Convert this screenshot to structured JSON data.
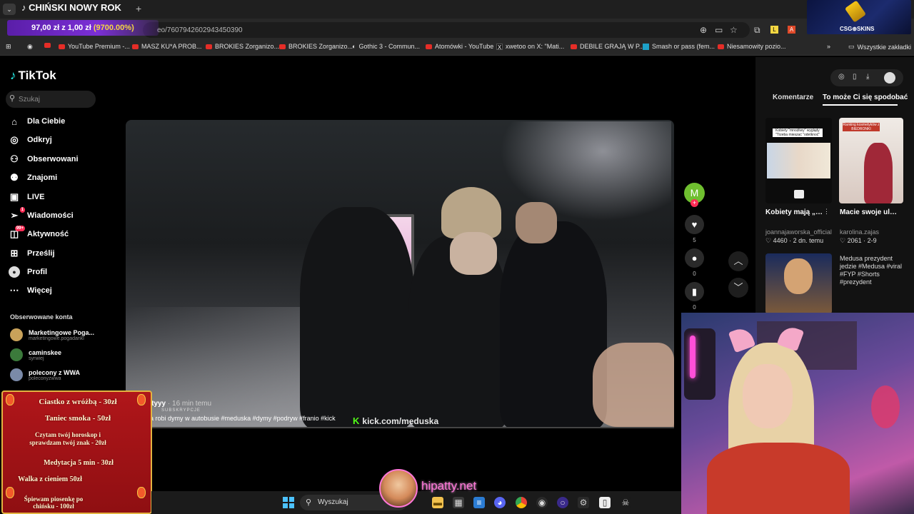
{
  "browser": {
    "tab_title": "CHIŃSKI NOWY ROK",
    "url": "eo/7607942602943450390",
    "bookmarks": [
      {
        "label": "YouTube Premium -...",
        "icon": "youtube"
      },
      {
        "label": "MASZ KU*A PROB...",
        "icon": "youtube"
      },
      {
        "label": "BROKIES Zorganizo...",
        "icon": "youtube"
      },
      {
        "label": "BROKIES Zorganizo...",
        "icon": "youtube"
      },
      {
        "label": "Gothic 3 - Commun...",
        "icon": "steam"
      },
      {
        "label": "Atomówki - YouTube",
        "icon": "youtube"
      },
      {
        "label": "xwetoo on X: \"Mati...",
        "icon": "x"
      },
      {
        "label": "DEBILE GRAJĄ W P...",
        "icon": "youtube"
      },
      {
        "label": "Smash or pass (fem...",
        "icon": "site"
      },
      {
        "label": "Niesamowity pozio...",
        "icon": "youtube"
      }
    ],
    "bookmarks_folder": "Wszystkie zakładki"
  },
  "donation_goal": {
    "current": "97,00 zł",
    "separator": "z",
    "target": "1,00 zł",
    "percent": "(9700.00%)"
  },
  "csg_banner": {
    "text": "CSG⊕SKINS"
  },
  "tiktok": {
    "logo": "TikTok",
    "search_placeholder": "Szukaj",
    "nav": [
      {
        "label": "Dla Ciebie",
        "icon": "home"
      },
      {
        "label": "Odkryj",
        "icon": "compass"
      },
      {
        "label": "Obserwowani",
        "icon": "following"
      },
      {
        "label": "Znajomi",
        "icon": "friends"
      },
      {
        "label": "LIVE",
        "icon": "live"
      },
      {
        "label": "Wiadomości",
        "icon": "messages",
        "badge": "1"
      },
      {
        "label": "Aktywność",
        "icon": "activity",
        "badge": "99+"
      },
      {
        "label": "Prześlij",
        "icon": "upload"
      },
      {
        "label": "Profil",
        "icon": "profile"
      },
      {
        "label": "Więcej",
        "icon": "more"
      }
    ],
    "followed_header": "Obserwowane konta",
    "followed": [
      {
        "name": "Marketingowe Poga...",
        "handle": "marketingowe.pogadanki"
      },
      {
        "name": "caminskee",
        "handle": "syrwiej"
      },
      {
        "name": "polecony z WWA",
        "handle": "poleconyzwwa"
      }
    ],
    "video": {
      "author": "otyyy",
      "time": "· 16 min temu",
      "subscribe": "SUBSKRYPCJE",
      "caption": "a robi dymy w autobusie #meduska #dymy #podryw #franio #kick",
      "watermark": "kick.com/meduska"
    },
    "actions": {
      "avatar_letter": "M",
      "likes": "5",
      "comments": "0",
      "saves": "0"
    },
    "right_panel": {
      "tabs": [
        "Komentarze",
        "To może Ci się spodobać"
      ],
      "cards": [
        {
          "thumb_caption": "Kobiety \"mnożliwy\" wyglądy \"Trzeba mieszać \"odetknoć\"",
          "title": "Kobiety mają „odetknonć\"...",
          "author": "joannajaworska_official",
          "likes": "4460",
          "date": "2 dn. temu"
        },
        {
          "thumb_caption": "Ranking kosmetyków z BIEDRONKI",
          "title": "Macie swoje ulubione serum z...",
          "author": "karolina.zajas",
          "likes": "2061",
          "date": "2-9"
        },
        {
          "title": "",
          "author": "",
          "likes": "",
          "date": ""
        },
        {
          "alt_text": "Medusa prezydent jedzie #Medusa #viral #FYP #Shorts #prezydent"
        }
      ]
    }
  },
  "stream_menu": {
    "items": [
      "Ciastko z wróżbą - 30zł",
      "Taniec smoka - 50zł",
      "Czytam twój horoskop i sprawdzam twój znak - 20zł",
      "Medytacja 5 min - 30zł",
      "Walka z cieniem 50zł",
      "Śpiewam piosenkę po chińsku - 100zł"
    ]
  },
  "streamer": {
    "site": "hipatty.net"
  },
  "taskbar": {
    "search_label": "Wyszukaj"
  },
  "colors": {
    "tiktok_red": "#fe2c55",
    "kick_green": "#53fc18",
    "donate_purple": "#7b2fd6",
    "hipatty_pink": "#ff77d8",
    "windows_blue": "#4cc2ff"
  }
}
